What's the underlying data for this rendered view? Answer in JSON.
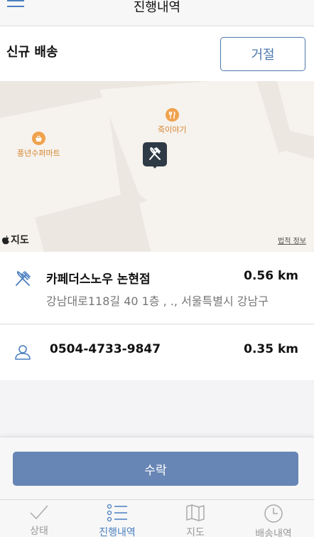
{
  "header": {
    "title": "진행내역",
    "menu_icon": "hamburger-menu-icon"
  },
  "new_delivery": {
    "label": "신규 배송",
    "reject_label": "거절"
  },
  "map": {
    "poi_store": {
      "label": "풍년수퍼마트",
      "icon": "basket-icon"
    },
    "poi_restaurant": {
      "label": "죽이야기",
      "icon": "fork-knife-icon"
    },
    "pin_icon": "fork-knife-icon",
    "brand": "지도",
    "legal": "법적 정보"
  },
  "pickup": {
    "icon": "fork-knife-icon",
    "name": "카페더스노우 논현점",
    "distance": "0.56 km",
    "address": "강남대로118길 40 1층 , ., 서울특별시 강남구"
  },
  "customer": {
    "icon": "person-icon",
    "phone": "0504-4733-9847",
    "distance": "0.35 km"
  },
  "accept_label": "수락",
  "tabs": [
    {
      "label": "상태",
      "icon": "check-icon",
      "active": false
    },
    {
      "label": "진행내역",
      "icon": "list-icon",
      "active": true
    },
    {
      "label": "지도",
      "icon": "map-icon",
      "active": false
    },
    {
      "label": "배송내역",
      "icon": "clock-icon",
      "active": false
    }
  ],
  "colors": {
    "accent": "#4a7fc0",
    "accept_button": "#6886b5",
    "poi_orange": "#f0a24e",
    "pin_dark": "#2e3a45"
  }
}
